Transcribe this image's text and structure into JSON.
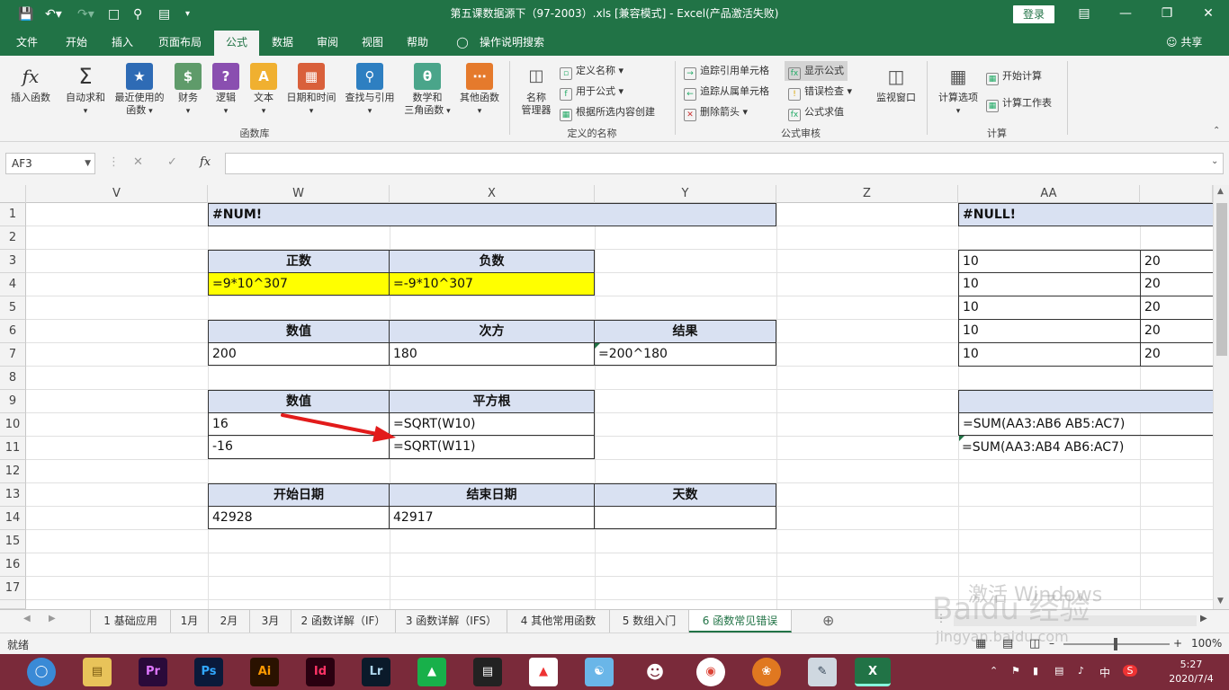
{
  "window": {
    "title": "第五课数据源下（97-2003）.xls  [兼容模式]  -  Excel(产品激活失败)",
    "login_label": "登录",
    "share_label": "共享"
  },
  "ribbon_tabs": [
    "文件",
    "开始",
    "插入",
    "页面布局",
    "公式",
    "数据",
    "审阅",
    "视图",
    "帮助",
    "操作说明搜索"
  ],
  "ribbon": {
    "insert_function": "插入函数",
    "autosum": "自动求和",
    "recent": "最近使用的",
    "recent2": "函数",
    "financial": "财务",
    "logical": "逻辑",
    "text": "文本",
    "datetime": "日期和时间",
    "lookup": "查找与引用",
    "math": "数学和",
    "math2": "三角函数",
    "more": "其他函数",
    "group_library": "函数库",
    "name_manager": "名称",
    "name_manager2": "管理器",
    "define_name": "定义名称",
    "use_in_formula": "用于公式",
    "create_from_sel": "根据所选内容创建",
    "group_names": "定义的名称",
    "trace_precedents": "追踪引用单元格",
    "trace_dependents": "追踪从属单元格",
    "remove_arrows": "删除箭头",
    "show_formulas": "显示公式",
    "error_checking": "错误检查",
    "evaluate": "公式求值",
    "watch": "监视窗口",
    "group_audit": "公式审核",
    "calc_options": "计算选项",
    "calc_now": "开始计算",
    "calc_sheet": "计算工作表",
    "group_calc": "计算"
  },
  "formula_bar": {
    "name_box": "AF3",
    "fx": "fx",
    "content": ""
  },
  "columns": [
    "V",
    "W",
    "X",
    "Y",
    "Z",
    "AA"
  ],
  "rows": [
    "1",
    "2",
    "3",
    "4",
    "5",
    "6",
    "7",
    "8",
    "9",
    "10",
    "11",
    "12",
    "13",
    "14",
    "15",
    "16",
    "17"
  ],
  "cells": {
    "W1": "#NUM!",
    "W3": "正数",
    "X3": "负数",
    "W4": "=9*10^307",
    "X4": "=-9*10^307",
    "W6": "数值",
    "X6": "次方",
    "Y6": "结果",
    "W7": "200",
    "X7": "180",
    "Y7": "=200^180",
    "W9": "数值",
    "X9": "平方根",
    "W10": "16",
    "X10": "=SQRT(W10)",
    "W11": "-16",
    "X11": "=SQRT(W11)",
    "W13": "开始日期",
    "X13": "结束日期",
    "Y13": "天数",
    "W14": "42928",
    "X14": "42917",
    "AA1": "#NULL!",
    "AA3": "10",
    "AB3": "20",
    "AA4": "10",
    "AB4": "20",
    "AA5": "10",
    "AB5": "20",
    "AA6": "10",
    "AB6": "20",
    "AA7": "10",
    "AB7": "20",
    "AA10": "=SUM(AA3:AB6 AB5:AC7)",
    "AA11": "=SUM(AA3:AB4 AB6:AC7)"
  },
  "sheet_tabs": [
    "1 基础应用",
    "1月",
    "2月",
    "3月",
    "2 函数详解（IF）",
    "3 函数详解（IFS）",
    "4 其他常用函数",
    "5 数组入门",
    "6 函数常见错误"
  ],
  "active_sheet": "6 函数常见错误",
  "status": {
    "ready": "就绪",
    "zoom": "100%"
  },
  "clock": {
    "time": "5:27",
    "date": "2020/7/4"
  },
  "tray_ime": "中",
  "watermark": {
    "activate": "激活 Windows",
    "brand": "Baidu 经验",
    "url": "jingyan.baidu.com"
  },
  "colors": {
    "excel_green": "#217346",
    "header_fill": "#d9e1f2",
    "highlight_yellow": "#ffff00",
    "arrow_red": "#e21b1b"
  }
}
